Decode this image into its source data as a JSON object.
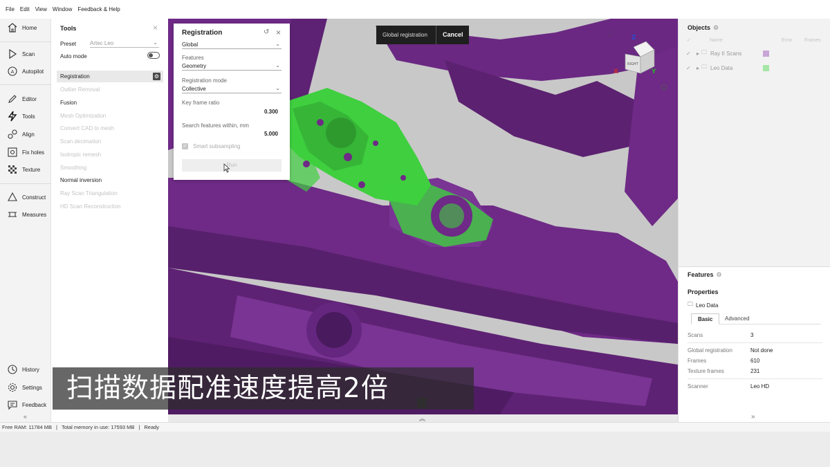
{
  "menu": [
    "File",
    "Edit",
    "View",
    "Window",
    "Feedback & Help"
  ],
  "nav": {
    "home": "Home",
    "scan": "Scan",
    "autopilot": "Autopilot",
    "editor": "Editor",
    "tools": "Tools",
    "align": "Align",
    "fix_holes": "Fix holes",
    "texture": "Texture",
    "construct": "Construct",
    "measures": "Measures",
    "history": "History",
    "settings": "Settings",
    "feedback": "Feedback"
  },
  "tools_panel": {
    "title": "Tools",
    "preset_label": "Preset",
    "preset_value": "Artec Leo",
    "auto_mode_label": "Auto mode",
    "items": [
      {
        "label": "Registration",
        "state": "active"
      },
      {
        "label": "Outlier Removal",
        "state": "disabled"
      },
      {
        "label": "Fusion",
        "state": "enabled"
      },
      {
        "label": "Mesh Optimization",
        "state": "disabled"
      },
      {
        "label": "Convert CAD to mesh",
        "state": "disabled"
      },
      {
        "label": "Scan decimation",
        "state": "disabled"
      },
      {
        "label": "Isotropic remesh",
        "state": "disabled"
      },
      {
        "label": "Smoothing",
        "state": "disabled"
      },
      {
        "label": "Normal inversion",
        "state": "enabled"
      },
      {
        "label": "Ray Scan Triangulation",
        "state": "disabled"
      },
      {
        "label": "HD Scan Reconstruction",
        "state": "disabled"
      }
    ]
  },
  "registration": {
    "title": "Registration",
    "type_value": "Global",
    "features_label": "Features",
    "features_value": "Geometry",
    "mode_label": "Registration mode",
    "mode_value": "Collective",
    "keyframe_label": "Key frame ratio",
    "keyframe_value": "0.300",
    "search_label": "Search features within, mm",
    "search_value": "5.000",
    "smart_label": "Smart subsampling",
    "run_label": "Run"
  },
  "banner": {
    "text": "Global registration",
    "cancel": "Cancel"
  },
  "cube": {
    "face": "RIGHT",
    "x": "X",
    "y": "Y",
    "z": "Z"
  },
  "objects": {
    "title": "Objects",
    "columns": {
      "name": "Name",
      "error": "Error",
      "frames": "Frames"
    },
    "rows": [
      {
        "name": "Ray II Scans",
        "color": "#c8a6d6"
      },
      {
        "name": "Leo Data",
        "color": "#a6e6a6"
      }
    ]
  },
  "features": {
    "title": "Features",
    "properties_title": "Properties",
    "object_name": "Leo Data",
    "tabs": {
      "basic": "Basic",
      "advanced": "Advanced"
    },
    "props": [
      {
        "k": "Scans",
        "v": "3"
      },
      {
        "k": "Global registration",
        "v": "Not done"
      },
      {
        "k": "Frames",
        "v": "610"
      },
      {
        "k": "Texture frames",
        "v": "231"
      },
      {
        "k": "Scanner",
        "v": "Leo HD"
      }
    ]
  },
  "status": {
    "free_ram": "Free RAM: 11784 MB",
    "total_memory": "Total memory in use: 17593 MB",
    "state": "Ready"
  },
  "subtitle": "扫描数据配准速度提高2倍",
  "colors": {
    "scan_purple": "#6e2a86",
    "scan_green": "#3fcf3f",
    "viewport_bg": "#c8c8c8"
  }
}
